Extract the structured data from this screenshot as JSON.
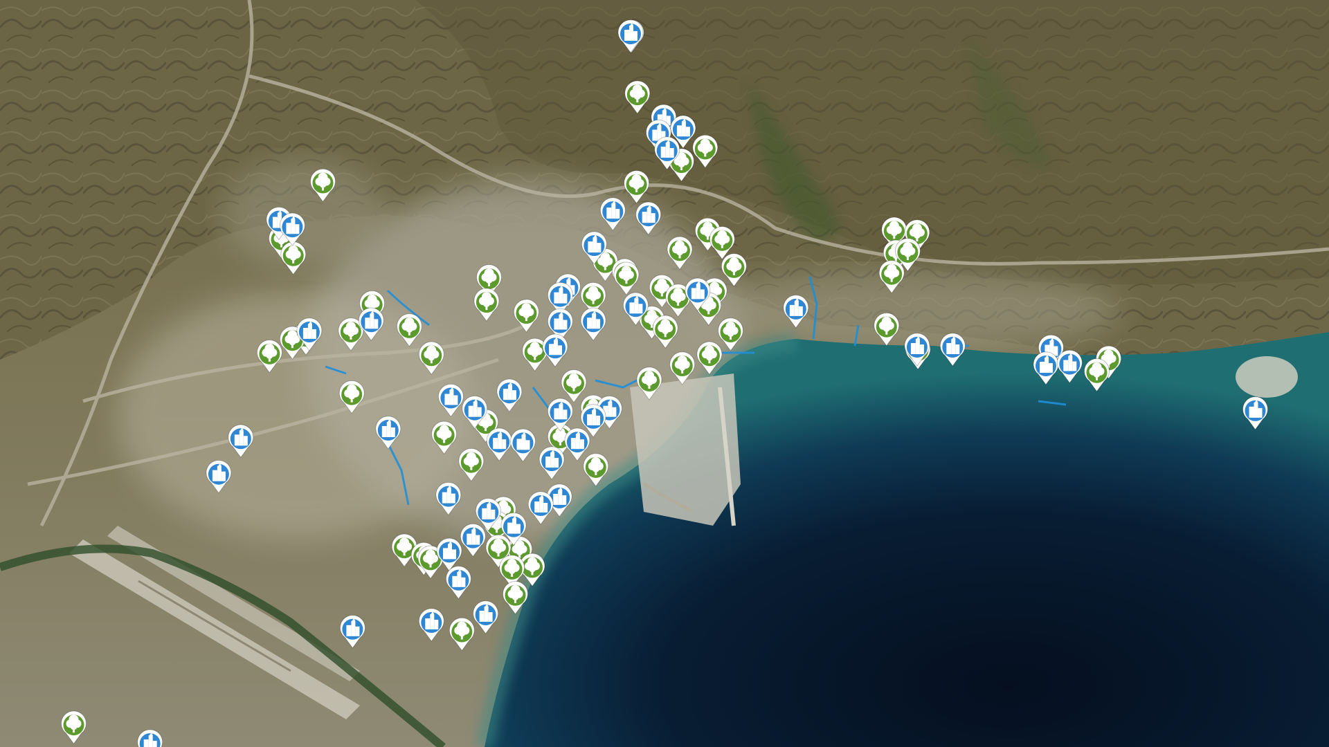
{
  "map": {
    "view": "satellite",
    "marker_types": {
      "tree": {
        "icon": "tree-icon",
        "color": "#5c9a2e",
        "ring": "#ffffff"
      },
      "building": {
        "icon": "building-icon",
        "color": "#2f86d2",
        "ring": "#ffffff"
      }
    },
    "colors": {
      "sea_deep": "#071a2e",
      "sea_mid": "#0d3a55",
      "sea_shallow": "#1d6e74",
      "city": "#a8a390",
      "mountain": "#6b6444",
      "path_blue": "#1f8fd8"
    }
  }
}
